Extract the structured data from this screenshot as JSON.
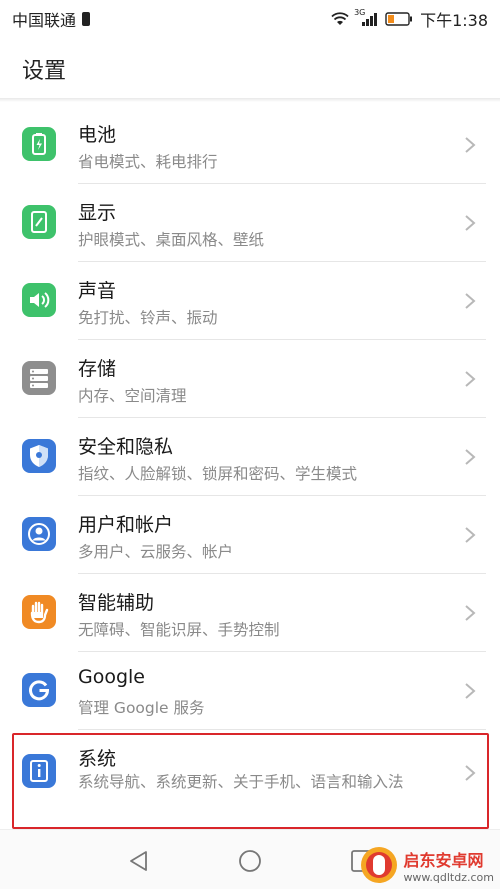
{
  "status_bar": {
    "carrier": "中国联通",
    "network_label": "3G",
    "time": "下午1:38"
  },
  "header": {
    "title": "设置"
  },
  "items": [
    {
      "title": "电池",
      "subtitle": "省电模式、耗电排行",
      "icon": "battery-icon",
      "color": "#3ec26b"
    },
    {
      "title": "显示",
      "subtitle": "护眼模式、桌面风格、壁纸",
      "icon": "display-icon",
      "color": "#3ec26b"
    },
    {
      "title": "声音",
      "subtitle": "免打扰、铃声、振动",
      "icon": "speaker-icon",
      "color": "#3ec26b"
    },
    {
      "title": "存储",
      "subtitle": "内存、空间清理",
      "icon": "storage-icon",
      "color": "#8e8e8e"
    },
    {
      "title": "安全和隐私",
      "subtitle": "指纹、人脸解锁、锁屏和密码、学生模式",
      "icon": "shield-icon",
      "color": "#3a78d8"
    },
    {
      "title": "用户和帐户",
      "subtitle": "多用户、云服务、帐户",
      "icon": "user-icon",
      "color": "#3a78d8"
    },
    {
      "title": "智能辅助",
      "subtitle": "无障碍、智能识屏、手势控制",
      "icon": "hand-icon",
      "color": "#f08a24"
    },
    {
      "title": "Google",
      "subtitle": "管理 Google 服务",
      "icon": "google-icon",
      "color": "#3a78d8"
    },
    {
      "title": "系统",
      "subtitle": "系统导航、系统更新、关于手机、语言和输入法",
      "icon": "info-icon",
      "color": "#3a78d8"
    }
  ],
  "watermark": {
    "name": "启东安卓网",
    "url": "www.qdltdz.com"
  },
  "colors": {
    "highlight": "#d9262a",
    "green": "#3ec26b",
    "blue": "#3a78d8",
    "orange": "#f08a24",
    "gray": "#8e8e8e"
  }
}
